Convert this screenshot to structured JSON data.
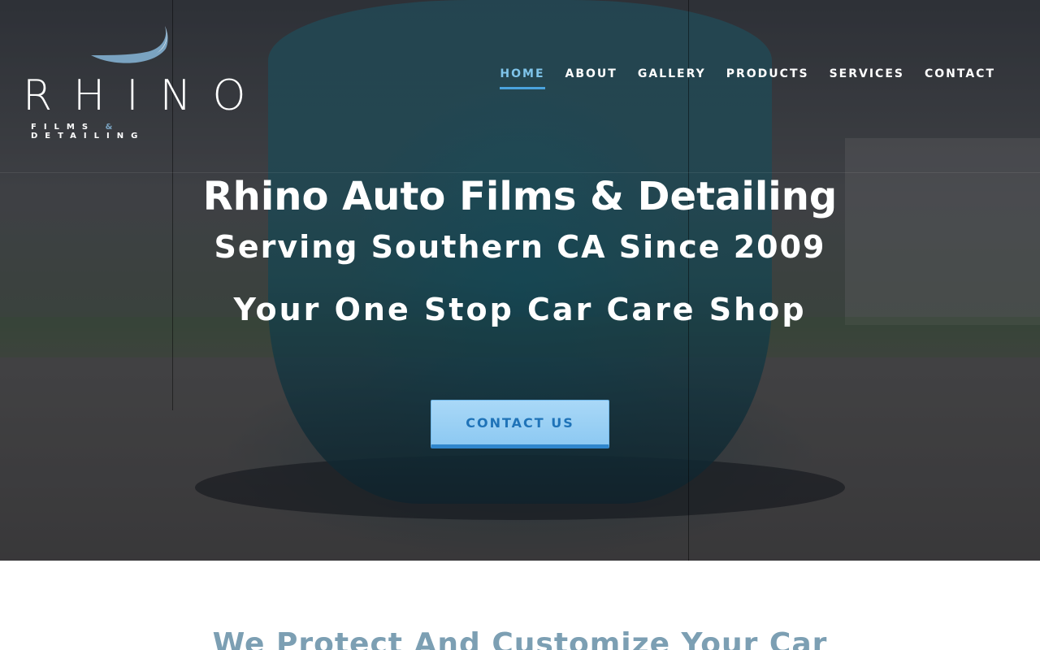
{
  "brand": {
    "wordmark": "RHINO",
    "tagline_part1": "FILMS",
    "tagline_amp": "&",
    "tagline_part2": "DETAILING",
    "accent_color": "#7aa3c1"
  },
  "nav": {
    "items": [
      {
        "label": "HOME",
        "active": true
      },
      {
        "label": "ABOUT",
        "active": false
      },
      {
        "label": "GALLERY",
        "active": false
      },
      {
        "label": "PRODUCTS",
        "active": false
      },
      {
        "label": "SERVICES",
        "active": false
      },
      {
        "label": "CONTACT",
        "active": false
      }
    ],
    "active_color": "#7fc4ea"
  },
  "hero": {
    "title": "Rhino Auto Films & Detailing",
    "subtitle": "Serving Southern CA Since 2009",
    "tagline": "Your One Stop Car Care Shop",
    "cta_label": "CONTACT US",
    "cta_color": "#8dc9f2"
  },
  "section": {
    "title": "We Protect And Customize Your Car",
    "title_color": "#7c9fb3"
  }
}
